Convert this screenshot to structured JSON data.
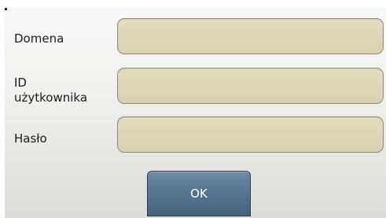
{
  "form": {
    "fields": [
      {
        "label": "Domena",
        "value": ""
      },
      {
        "label": "ID\nużytkownika",
        "value": ""
      },
      {
        "label": "Hasło",
        "value": ""
      }
    ],
    "ok_label": "OK"
  },
  "colors": {
    "field_fill": "#dcd5b2",
    "button_fill": "#587591",
    "label_text": "#1c1c1c"
  }
}
